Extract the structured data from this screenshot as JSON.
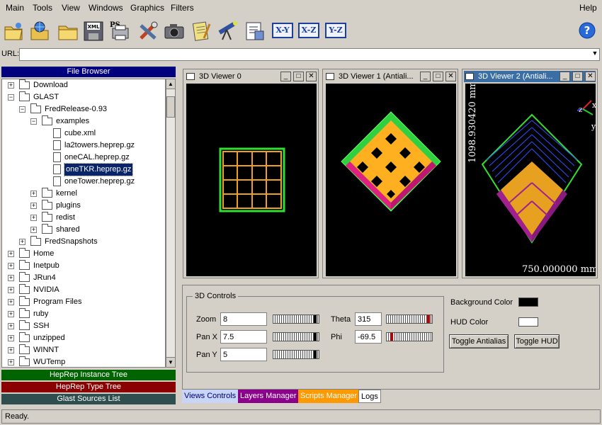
{
  "menus": [
    "Main",
    "Tools",
    "View",
    "Windows",
    "Graphics",
    "Filters"
  ],
  "help_menu": "Help",
  "toolbar": {
    "icons": [
      "open-file-icon",
      "network-open-icon",
      "folder-icon",
      "xml-save-icon",
      "ps-print-icon",
      "tools-icon",
      "camera-icon",
      "notepad-icon",
      "telescope-icon",
      "script-icon"
    ],
    "xml_label": "XML",
    "ps_label": "PS",
    "axes": [
      "X-Y",
      "X-Z",
      "Y-Z"
    ]
  },
  "url": {
    "label": "URL:",
    "value": ""
  },
  "file_browser": {
    "title": "File Browser",
    "rows": [
      {
        "label": "Download",
        "depth": 0,
        "state": "+",
        "type": "folder"
      },
      {
        "label": "GLAST",
        "depth": 0,
        "state": "-",
        "type": "folder"
      },
      {
        "label": "FredRelease-0.93",
        "depth": 1,
        "state": "-",
        "type": "folder"
      },
      {
        "label": "examples",
        "depth": 2,
        "state": "-",
        "type": "folder"
      },
      {
        "label": "cube.xml",
        "depth": 3,
        "state": "",
        "type": "file"
      },
      {
        "label": "la2towers.heprep.gz",
        "depth": 3,
        "state": "",
        "type": "file"
      },
      {
        "label": "oneCAL.heprep.gz",
        "depth": 3,
        "state": "",
        "type": "file"
      },
      {
        "label": "oneTKR.heprep.gz",
        "depth": 3,
        "state": "",
        "type": "file",
        "selected": true
      },
      {
        "label": "oneTower.heprep.gz",
        "depth": 3,
        "state": "",
        "type": "file"
      },
      {
        "label": "kernel",
        "depth": 2,
        "state": "+",
        "type": "folder"
      },
      {
        "label": "plugins",
        "depth": 2,
        "state": "+",
        "type": "folder"
      },
      {
        "label": "redist",
        "depth": 2,
        "state": "+",
        "type": "folder"
      },
      {
        "label": "shared",
        "depth": 2,
        "state": "+",
        "type": "folder"
      },
      {
        "label": "FredSnapshots",
        "depth": 1,
        "state": "+",
        "type": "folder"
      },
      {
        "label": "Home",
        "depth": 0,
        "state": "+",
        "type": "folder"
      },
      {
        "label": "Inetpub",
        "depth": 0,
        "state": "+",
        "type": "folder"
      },
      {
        "label": "JRun4",
        "depth": 0,
        "state": "+",
        "type": "folder"
      },
      {
        "label": "NVIDIA",
        "depth": 0,
        "state": "+",
        "type": "folder"
      },
      {
        "label": "Program Files",
        "depth": 0,
        "state": "+",
        "type": "folder"
      },
      {
        "label": "ruby",
        "depth": 0,
        "state": "+",
        "type": "folder"
      },
      {
        "label": "SSH",
        "depth": 0,
        "state": "+",
        "type": "folder"
      },
      {
        "label": "unzipped",
        "depth": 0,
        "state": "+",
        "type": "folder"
      },
      {
        "label": "WINNT",
        "depth": 0,
        "state": "+",
        "type": "folder"
      },
      {
        "label": "WUTemp",
        "depth": 0,
        "state": "+",
        "type": "folder"
      }
    ]
  },
  "panes": [
    {
      "label": "HepRep Instance Tree",
      "color": "#006400"
    },
    {
      "label": "HepRep Type Tree",
      "color": "#8b0000"
    },
    {
      "label": "Glast Sources List",
      "color": "#2f4f4f"
    }
  ],
  "viewers": [
    {
      "title": "3D Viewer 0"
    },
    {
      "title": "3D Viewer 1 (Antiali..."
    },
    {
      "title": "3D Viewer 2 (Antiali...",
      "scale_vertical": "1098.930420 mm",
      "scale_horizontal": "750.000000 mm",
      "axes": [
        "x",
        "z",
        "y"
      ]
    }
  ],
  "window_buttons": {
    "minimize": "_",
    "maximize": "□",
    "close": "✕"
  },
  "controls": {
    "group_title": "3D Controls",
    "zoom": {
      "label": "Zoom",
      "value": "8",
      "slider": 0.95
    },
    "pan_x": {
      "label": "Pan X",
      "value": "7.5",
      "slider": 0.95
    },
    "pan_y": {
      "label": "Pan Y",
      "value": "5",
      "slider": 0.95
    },
    "theta": {
      "label": "Theta",
      "value": "315",
      "slider": 0.95
    },
    "phi": {
      "label": "Phi",
      "value": "-69.5",
      "slider": 0.08
    },
    "background_label": "Background Color",
    "background_color": "#000000",
    "hud_label": "HUD Color",
    "hud_color": "#ffffff",
    "toggle_antialias": "Toggle Antialias",
    "toggle_hud": "Toggle HUD"
  },
  "tabs": [
    {
      "label": "Views Controls",
      "color": "#c8d4f8",
      "text": "#00006f"
    },
    {
      "label": "Layers Manager",
      "color": "#8b008b",
      "text": "#ffffff"
    },
    {
      "label": "Scripts Manager",
      "color": "#ff9900",
      "text": "#ffffff"
    },
    {
      "label": "Logs",
      "color": "#ffffff",
      "text": "#000000"
    }
  ],
  "status": "Ready."
}
